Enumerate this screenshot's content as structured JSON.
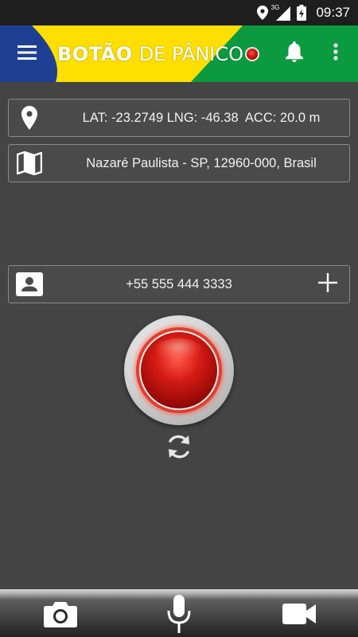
{
  "status_bar": {
    "time": "09:37",
    "network": "3G",
    "icons": [
      "location-icon",
      "cell-signal-icon",
      "battery-charging-icon"
    ]
  },
  "app_bar": {
    "title_bold": "BOTÃO",
    "title_light": "DE PÂNICO",
    "icons": [
      "menu-icon",
      "bell-icon",
      "more-vert-icon"
    ],
    "colors": {
      "green": "#0b9a40",
      "yellow": "#fedf00",
      "blue": "#002776"
    }
  },
  "location": {
    "icon": "map-pin-icon",
    "coords_text": "LAT: -23.2749 LNG: -46.38  ACC: 20.0 m"
  },
  "address": {
    "icon": "map-icon",
    "text": "Nazaré Paulista - SP, 12960-000, Brasil"
  },
  "contact": {
    "icon": "contact-card-icon",
    "phone": "+55 555 444 3333",
    "add_icon": "plus-icon"
  },
  "panic_button": {
    "color": "#d41b14"
  },
  "refresh_icon": "refresh-icon",
  "bottom_bar": {
    "icons": [
      "camera-icon",
      "microphone-icon",
      "video-camera-icon"
    ]
  }
}
